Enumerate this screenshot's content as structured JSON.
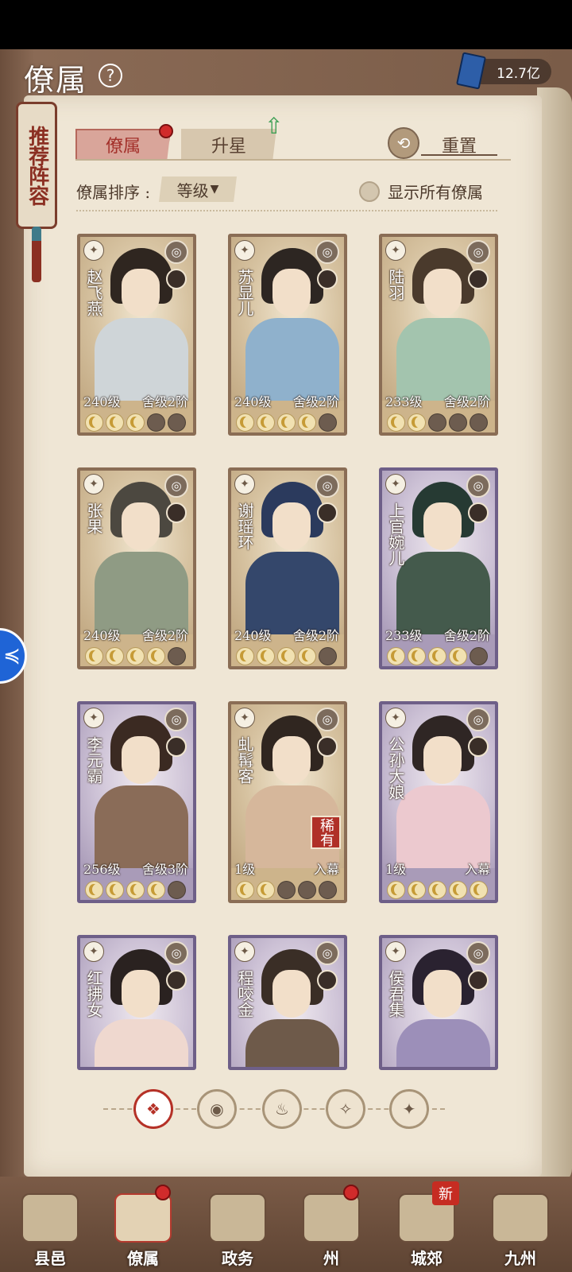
{
  "header": {
    "title": "僚属",
    "currency_value": "12.7亿"
  },
  "banner": {
    "text": "推荐阵容"
  },
  "tabs": [
    {
      "label": "僚属",
      "active": true,
      "has_dot": true
    },
    {
      "label": "升星",
      "active": false,
      "has_up_arrow": true
    }
  ],
  "reset_label": "重置",
  "sort": {
    "label": "僚属排序 :",
    "value": "等级"
  },
  "show_all_label": "显示所有僚属",
  "cards": [
    {
      "name": "赵飞燕",
      "level": "240级",
      "rank": "舍级2阶",
      "stars_lit": 3,
      "stars_total": 5,
      "theme": "gold",
      "robe": "#cfd5d8",
      "hair": "#2f2620"
    },
    {
      "name": "苏显儿",
      "level": "240级",
      "rank": "舍级2阶",
      "stars_lit": 4,
      "stars_total": 5,
      "theme": "gold",
      "robe": "#8fb1cc",
      "hair": "#2d2622"
    },
    {
      "name": "陆羽",
      "level": "233级",
      "rank": "舍级2阶",
      "stars_lit": 2,
      "stars_total": 5,
      "theme": "gold",
      "robe": "#a3c4ae",
      "hair": "#4a3a2c"
    },
    {
      "name": "张果",
      "level": "240级",
      "rank": "舍级2阶",
      "stars_lit": 4,
      "stars_total": 5,
      "theme": "gold",
      "robe": "#8f9b84",
      "hair": "#4c4840"
    },
    {
      "name": "谢瑶环",
      "level": "240级",
      "rank": "舍级2阶",
      "stars_lit": 4,
      "stars_total": 5,
      "theme": "gold",
      "robe": "#34476b",
      "hair": "#2b3a5d"
    },
    {
      "name": "上官婉儿",
      "level": "233级",
      "rank": "舍级2阶",
      "stars_lit": 4,
      "stars_total": 5,
      "theme": "purple",
      "robe": "#445a4c",
      "hair": "#263a33"
    },
    {
      "name": "李元霸",
      "level": "256级",
      "rank": "舍级3阶",
      "stars_lit": 4,
      "stars_total": 5,
      "theme": "purple",
      "robe": "#8a6c58",
      "hair": "#3b2a22"
    },
    {
      "name": "虬髯客",
      "level": "1级",
      "rank": "入幕",
      "stars_lit": 2,
      "stars_total": 5,
      "theme": "gold",
      "robe": "#d6b79b",
      "hair": "#302620",
      "tag": "稀有"
    },
    {
      "name": "公孙大娘",
      "level": "1级",
      "rank": "入幕",
      "stars_lit": 5,
      "stars_total": 5,
      "theme": "purple",
      "robe": "#ecc9cf",
      "hair": "#2f2624"
    },
    {
      "name": "红拂女",
      "level": "",
      "rank": "",
      "stars_lit": 0,
      "stars_total": 0,
      "theme": "purple",
      "robe": "#efd8cf",
      "hair": "#2a2220"
    },
    {
      "name": "程咬金",
      "level": "",
      "rank": "",
      "stars_lit": 0,
      "stars_total": 0,
      "theme": "purple",
      "robe": "#6e5a4a",
      "hair": "#3a2e26"
    },
    {
      "name": "侯君集",
      "level": "",
      "rank": "",
      "stars_lit": 0,
      "stars_total": 0,
      "theme": "purple",
      "robe": "#9c8fb9",
      "hair": "#2a2230"
    }
  ],
  "filters": [
    {
      "icon": "all-icon",
      "glyph": "❖",
      "active": true
    },
    {
      "icon": "bell-class-icon",
      "glyph": "◉",
      "active": false
    },
    {
      "icon": "gourd-class-icon",
      "glyph": "♨",
      "active": false
    },
    {
      "icon": "fan-class-icon",
      "glyph": "✧",
      "active": false
    },
    {
      "icon": "beast-class-icon",
      "glyph": "✦",
      "active": false
    }
  ],
  "nav": [
    {
      "label": "县邑",
      "active": false,
      "dot": false,
      "new": false
    },
    {
      "label": "僚属",
      "active": true,
      "dot": true,
      "new": false
    },
    {
      "label": "政务",
      "active": false,
      "dot": false,
      "new": false
    },
    {
      "label": "州",
      "active": false,
      "dot": true,
      "new": false
    },
    {
      "label": "城郊",
      "active": false,
      "dot": false,
      "new": true,
      "new_label": "新"
    },
    {
      "label": "九州",
      "active": false,
      "dot": false,
      "new": false
    }
  ],
  "side_button": {
    "glyph": "≼"
  }
}
